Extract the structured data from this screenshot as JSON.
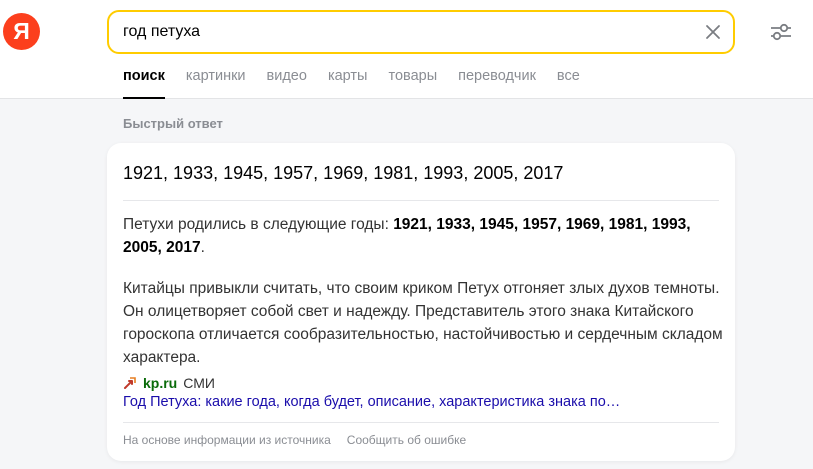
{
  "logo": {
    "letter": "Я"
  },
  "search": {
    "query": "год петуха",
    "placeholder": ""
  },
  "tabs": [
    {
      "label": "поиск",
      "active": true
    },
    {
      "label": "картинки"
    },
    {
      "label": "видео"
    },
    {
      "label": "карты"
    },
    {
      "label": "товары"
    },
    {
      "label": "переводчик"
    },
    {
      "label": "все"
    }
  ],
  "quick_answer": {
    "section_label": "Быстрый ответ",
    "title": "1921, 1933, 1945, 1957, 1969, 1981, 1993, 2005, 2017",
    "para1_prefix": "Петухи родились в следующие годы: ",
    "para1_years": "1921, 1933, 1945, 1957, 1969, 1981, 1993, 2005, 2017",
    "para1_suffix": ".",
    "para2": "Китайцы привыкли считать, что своим криком Петух отгоняет злых духов темноты. Он олицетворяет собой свет и надежду. Представитель этого знака Китайского гороскопа отличается сообразительностью, настойчивостью и сердечным складом характера.",
    "source_domain": "kp.ru",
    "source_type": "СМИ",
    "source_link": "Год Петуха: какие года, когда будет, описание, характеристика знака по…",
    "footer_info": "На основе информации из источника",
    "footer_report": "Сообщить об ошибке"
  },
  "colors": {
    "logo_red": "#fc3f1d",
    "search_border": "#ffcc00",
    "link_blue": "#1a0dab",
    "source_green": "#0a6b0a"
  }
}
